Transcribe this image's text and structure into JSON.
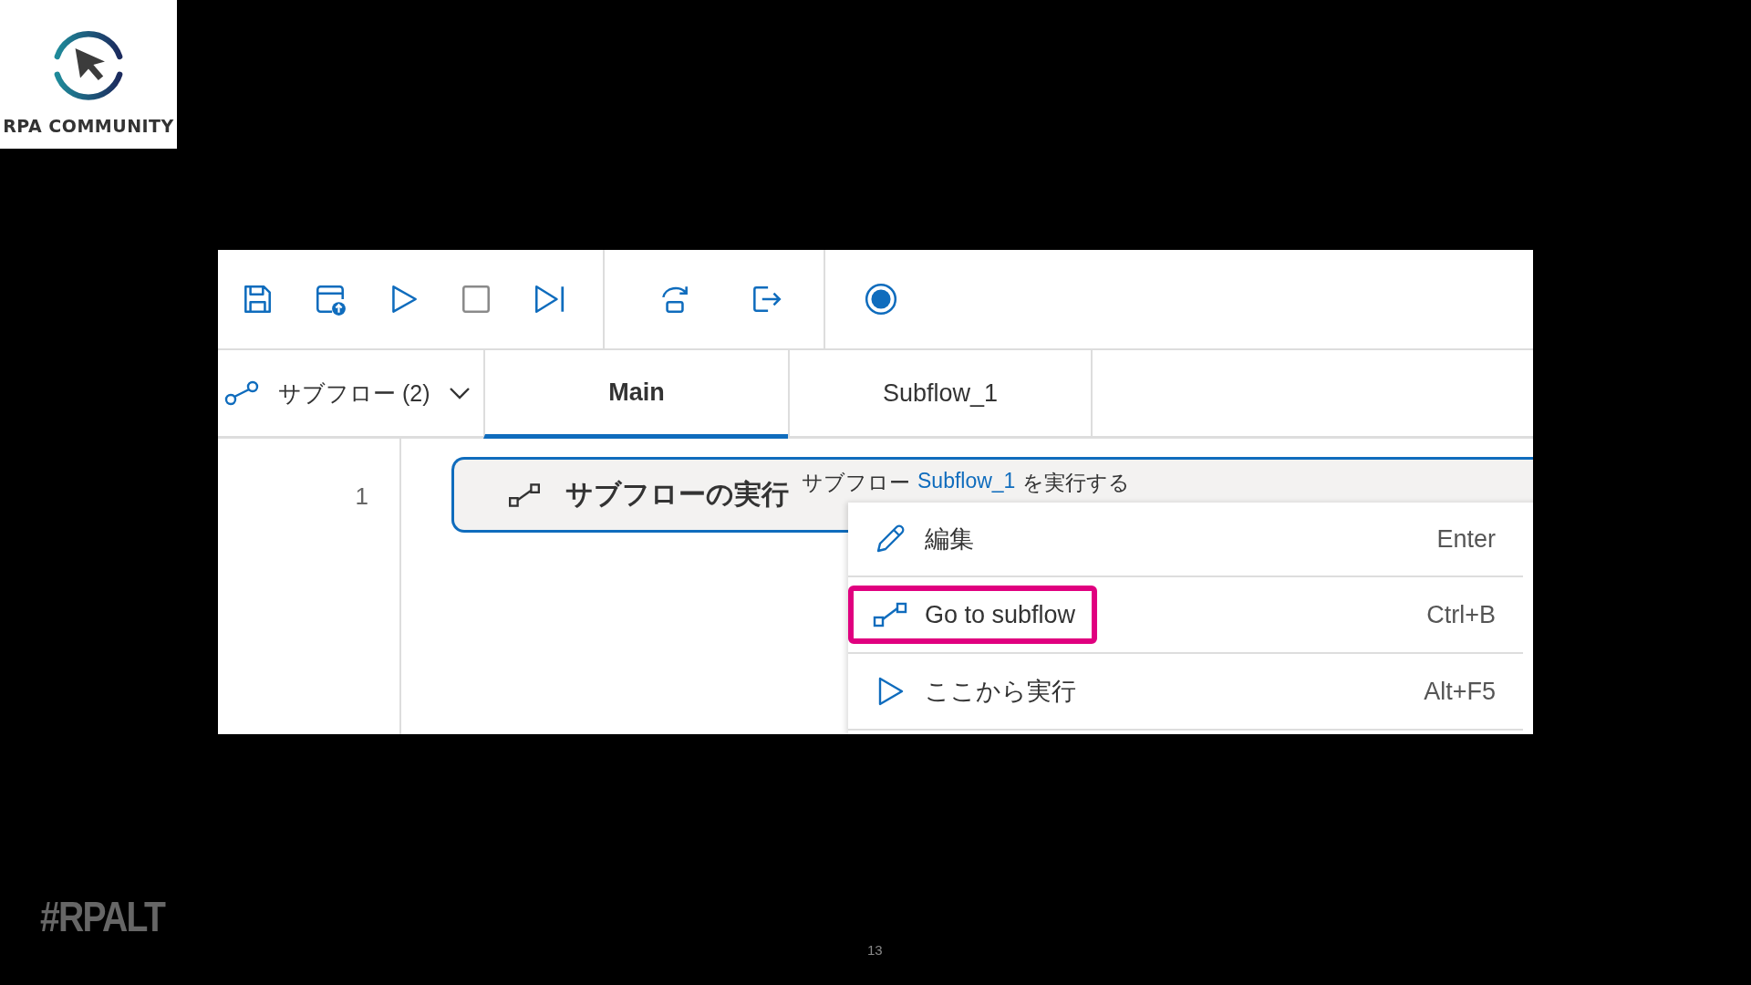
{
  "logo": {
    "text": "RPA COMMUNITY"
  },
  "subflows_dropdown": {
    "label": "サブフロー (2)"
  },
  "tabs": [
    {
      "label": "Main",
      "selected": true
    },
    {
      "label": "Subflow_1",
      "selected": false
    }
  ],
  "actions": [
    {
      "line": "1",
      "title": "サブフローの実行",
      "description_prefix": "サブフロー",
      "link": "Subflow_1",
      "description_suffix": "を実行する",
      "selected": true
    }
  ],
  "context_menu": {
    "items": [
      {
        "kind": "edit",
        "label": "編集",
        "shortcut": "Enter",
        "highlighted": false
      },
      {
        "kind": "subflow",
        "label": "Go to subflow",
        "shortcut": "Ctrl+B",
        "highlighted": true
      },
      {
        "kind": "run",
        "label": "ここから実行",
        "shortcut": "Alt+F5",
        "highlighted": false
      }
    ]
  },
  "hashtag": "#RPALT",
  "page_number": "13"
}
